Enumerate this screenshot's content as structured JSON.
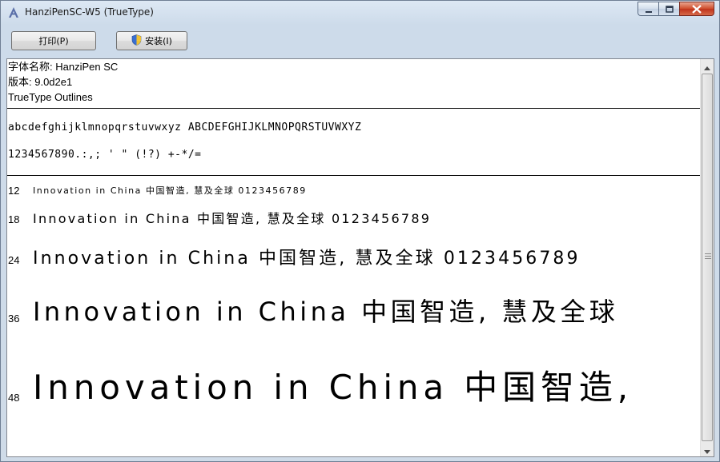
{
  "window": {
    "title": "HanziPenSC-W5 (TrueType)",
    "accent_color": "#cfdbe9",
    "close_color": "#c7452a"
  },
  "toolbar": {
    "print_label": "打印(P)",
    "install_label": "安装(I)"
  },
  "font_info": {
    "name_line": "字体名称: HanziPen SC",
    "version_line": "版本: 9.0d2e1",
    "outline_line": "TrueType Outlines"
  },
  "character_set": {
    "letters": "abcdefghijklmnopqrstuvwxyz ABCDEFGHIJKLMNOPQRSTUVWXYZ",
    "digits_symbols": "1234567890.:,; ' \" (!?) +-*/="
  },
  "samples": [
    {
      "size": "12",
      "text": "Innovation in China 中国智造, 慧及全球 0123456789"
    },
    {
      "size": "18",
      "text": "Innovation in China 中国智造, 慧及全球 0123456789"
    },
    {
      "size": "24",
      "text": "Innovation in China 中国智造, 慧及全球 0123456789"
    },
    {
      "size": "36",
      "text": "Innovation in China 中国智造, 慧及全球"
    },
    {
      "size": "48",
      "text": "Innovation in China 中国智造,"
    }
  ],
  "icons": {
    "app": "font-preview-icon",
    "install": "shield-icon",
    "minimize": "minimize-icon",
    "maximize": "maximize-icon",
    "close": "close-icon"
  }
}
